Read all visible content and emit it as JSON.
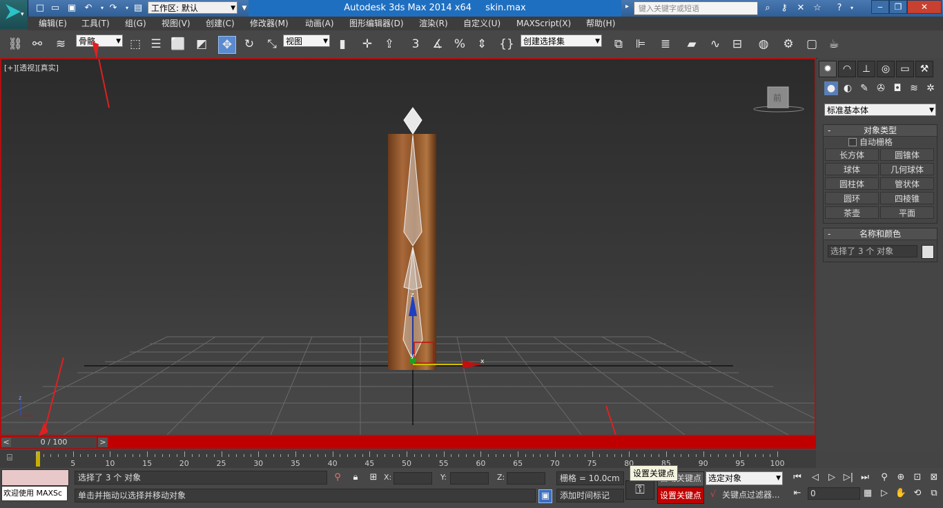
{
  "titlebar": {
    "workspace_label": "工作区: 默认",
    "app_name": "Autodesk 3ds Max  2014 x64",
    "file_name": "skin.max",
    "search_placeholder": "键入关键字或短语"
  },
  "menus": [
    "编辑(E)",
    "工具(T)",
    "组(G)",
    "视图(V)",
    "创建(C)",
    "修改器(M)",
    "动画(A)",
    "图形编辑器(D)",
    "渲染(R)",
    "自定义(U)",
    "MAXScript(X)",
    "帮助(H)"
  ],
  "toolbar": {
    "selection_filter": "骨骼",
    "coord_system": "视图",
    "named_selection": "创建选择集",
    "snap_angle_label": "3"
  },
  "viewport": {
    "label": "[+][透视][真实]",
    "viewcube_label": "前",
    "axis_x": "x",
    "axis_y": "y",
    "axis_z": "z"
  },
  "command_panel": {
    "category_dropdown": "标准基本体",
    "object_type": {
      "title": "对象类型",
      "auto_grid": "自动栅格",
      "buttons": [
        "长方体",
        "圆锥体",
        "球体",
        "几何球体",
        "圆柱体",
        "管状体",
        "圆环",
        "四棱锥",
        "茶壶",
        "平面"
      ]
    },
    "name_color": {
      "title": "名称和颜色",
      "name_value": "选择了 3 个 对象"
    }
  },
  "timeline": {
    "frame_display": "0 / 100",
    "ticks": [
      "5",
      "10",
      "15",
      "20",
      "25",
      "30",
      "35",
      "40",
      "45",
      "50",
      "55",
      "60",
      "65",
      "70",
      "75",
      "80",
      "85",
      "90",
      "95",
      "100"
    ]
  },
  "status": {
    "maxscript_text": "欢迎使用 MAXSc",
    "selection_info": "选择了 3 个 对象",
    "prompt": "单击并拖动以选择并移动对象",
    "x_label": "X:",
    "y_label": "Y:",
    "z_label": "Z:",
    "grid": "栅格 = 10.0cm",
    "add_time_tag": "添加时间标记",
    "auto_key": "自动关键点",
    "set_key": "设置关键点",
    "key_filter": "关键点过滤器...",
    "selected_object": "选定对象",
    "tooltip": "设置关键点",
    "current_frame": "0"
  },
  "colors": {
    "active_red": "#c00000",
    "viewport_border": "#b01010",
    "title_blue": "#1f6fc0"
  }
}
